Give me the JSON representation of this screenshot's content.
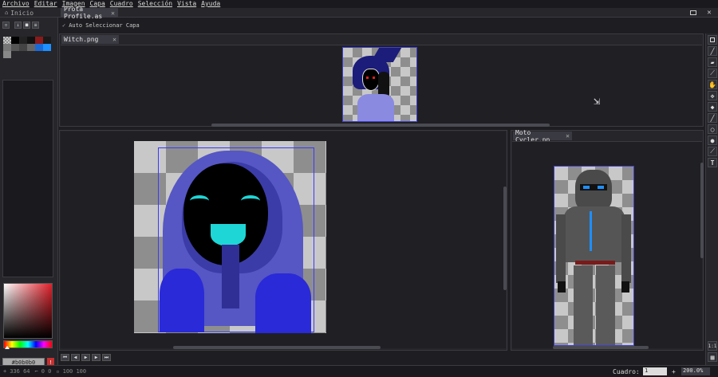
{
  "menu": [
    "Archivo",
    "Editar",
    "Imagen",
    "Capa",
    "Cuadro",
    "Selección",
    "Vista",
    "Ayuda"
  ],
  "tabs": {
    "home": "Inicio",
    "doc": "Prota Profile.as",
    "close": "✕"
  },
  "window": {
    "fullscreen_icon": "fullscreen-icon",
    "close": "✕"
  },
  "options": {
    "auto_select_label": "Auto Seleccionar Capa"
  },
  "panels": {
    "witch": {
      "title": "Witch.png",
      "close": "✕"
    },
    "moto": {
      "title": "Moto Cycler.pn",
      "close": "✕"
    }
  },
  "color": {
    "hex": "#b0b0b0",
    "warning": "!"
  },
  "tools": [
    "rect-select-icon",
    "pencil-icon",
    "eraser-icon",
    "brush-icon",
    "hand-icon",
    "move-icon",
    "fill-icon",
    "line-icon",
    "ellipse-icon",
    "blur-icon",
    "eyedropper-icon",
    "text-icon"
  ],
  "text_tool_label": "T",
  "status": {
    "coords": "336 64",
    "sel": "0 0",
    "size": "100 100",
    "frame_label": "Cuadro:",
    "frame_value": "1",
    "zoom": "200.0%",
    "ratio_label": "1:1"
  },
  "playback": [
    "⏮",
    "◀",
    "▶",
    "▶",
    "⏭"
  ],
  "colors": {
    "accent": "#3a3a42",
    "hood_light": "#5c5ccc",
    "hood_dark": "#3c3ca8",
    "face": "#000000",
    "cyan": "#1ed6d6",
    "blue_sel": "#2a2aff"
  }
}
